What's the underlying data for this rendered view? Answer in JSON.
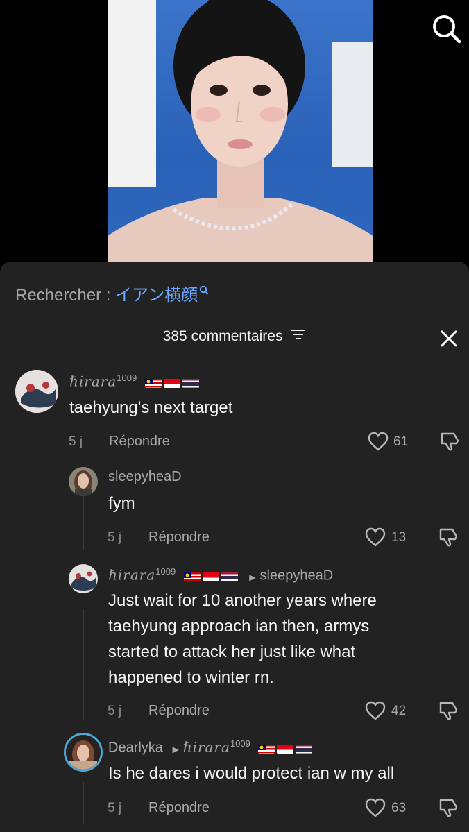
{
  "search": {
    "prefix": "Rechercher : ",
    "term": "イアン横顔",
    "icon": "search-icon"
  },
  "comments_header": {
    "count_label": "385 commentaires"
  },
  "flags": [
    "malaysia",
    "indonesia",
    "thailand"
  ],
  "comments": [
    {
      "username": "ℏ𝑖𝑟𝑎𝑟𝑎",
      "username_sup": "1009",
      "text": "taehyung's next target",
      "time": "5 j",
      "reply_label": "Répondre",
      "likes": "61"
    },
    {
      "username": "sleepyheaD",
      "text": "fym",
      "time": "5 j",
      "reply_label": "Répondre",
      "likes": "13"
    },
    {
      "username": "ℏ𝑖𝑟𝑎𝑟𝑎",
      "username_sup": "1009",
      "reply_to": "sleepyheaD",
      "text_lines": [
        "Just wait for 10 another years where",
        "taehyung approach ian then, armys",
        "started to attack her just like what",
        "happened to winter rn."
      ],
      "time": "5 j",
      "reply_label": "Répondre",
      "likes": "42"
    },
    {
      "username": "Dearlyka",
      "reply_to": "ℏ𝑖𝑟𝑎𝑟𝑎",
      "reply_to_sup": "1009",
      "text": "Is he dares i would protect ian w my all",
      "time": "5 j",
      "reply_label": "Répondre",
      "likes": "63"
    }
  ]
}
